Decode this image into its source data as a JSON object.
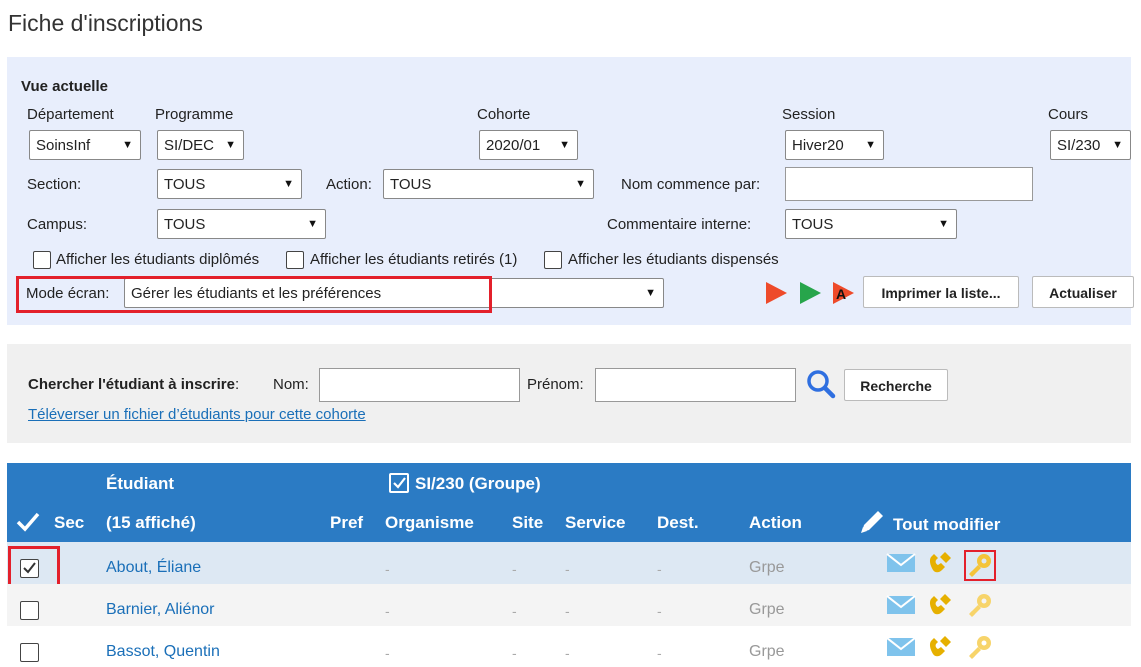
{
  "page": {
    "title": "Fiche d'inscriptions"
  },
  "view": {
    "heading": "Vue actuelle",
    "departement": {
      "label": "Département",
      "value": "SoinsInf"
    },
    "programme": {
      "label": "Programme",
      "value": "SI/DEC"
    },
    "cohorte": {
      "label": "Cohorte",
      "value": "2020/01"
    },
    "session": {
      "label": "Session",
      "value": "Hiver20"
    },
    "cours": {
      "label": "Cours",
      "value": "SI/230"
    },
    "section": {
      "label": "Section:",
      "value": "TOUS"
    },
    "action": {
      "label": "Action:",
      "value": "TOUS"
    },
    "nom_commence": {
      "label": "Nom commence par:",
      "value": ""
    },
    "campus": {
      "label": "Campus:",
      "value": "TOUS"
    },
    "commentaire": {
      "label": "Commentaire interne:",
      "value": "TOUS"
    },
    "checkboxes": {
      "diplomes": "Afficher les étudiants diplômés",
      "retires": "Afficher les étudiants retirés (1)",
      "dispenses": "Afficher les étudiants dispensés"
    },
    "mode": {
      "label": "Mode écran:",
      "value": "Gérer les étudiants et les préférences"
    },
    "buttons": {
      "imprimer": "Imprimer la liste...",
      "actualiser": "Actualiser"
    },
    "icon_a_letter": "A"
  },
  "search": {
    "label": "Chercher l'étudiant à inscrire",
    "colon": ":",
    "nom_label": "Nom:",
    "prenom_label": "Prénom:",
    "button": "Recherche",
    "upload_link": "Téléverser un fichier d’étudiants pour cette cohorte"
  },
  "table": {
    "header": {
      "etudiant": "Étudiant",
      "affiche": "(15 affiché)",
      "course_group": "SI/230  (Groupe)",
      "sec": "Sec",
      "pref": "Pref",
      "organisme": "Organisme",
      "site": "Site",
      "service": "Service",
      "dest": "Dest.",
      "action": "Action",
      "tout_modifier": "Tout modifier"
    },
    "rows": [
      {
        "name": "About, Éliane",
        "checked": true,
        "organisme": "-",
        "site": "-",
        "service": "-",
        "dest": "-",
        "action": "Grpe"
      },
      {
        "name": "Barnier, Aliénor",
        "checked": false,
        "organisme": "-",
        "site": "-",
        "service": "-",
        "dest": "-",
        "action": "Grpe"
      },
      {
        "name": "Bassot, Quentin",
        "checked": false,
        "organisme": "-",
        "site": "-",
        "service": "-",
        "dest": "-",
        "action": "Grpe"
      }
    ]
  },
  "colors": {
    "panel_bg": "#e8eefc",
    "header_bg": "#2b7bc4",
    "selected_row_bg": "#dde8f3",
    "link": "#1a6fb8",
    "highlight_red": "#e3202b",
    "play_red": "#ee4a2a",
    "play_green": "#27a54b",
    "mail_blue": "#7fc3ec",
    "phone_gold": "#e6b000",
    "key_gold": "#f4c43a"
  },
  "icons": [
    "play-red-icon",
    "play-green-icon",
    "play-a-icon",
    "search-icon",
    "checkmark-icon",
    "pencil-icon",
    "mail-icon",
    "phone-icon",
    "key-icon"
  ]
}
